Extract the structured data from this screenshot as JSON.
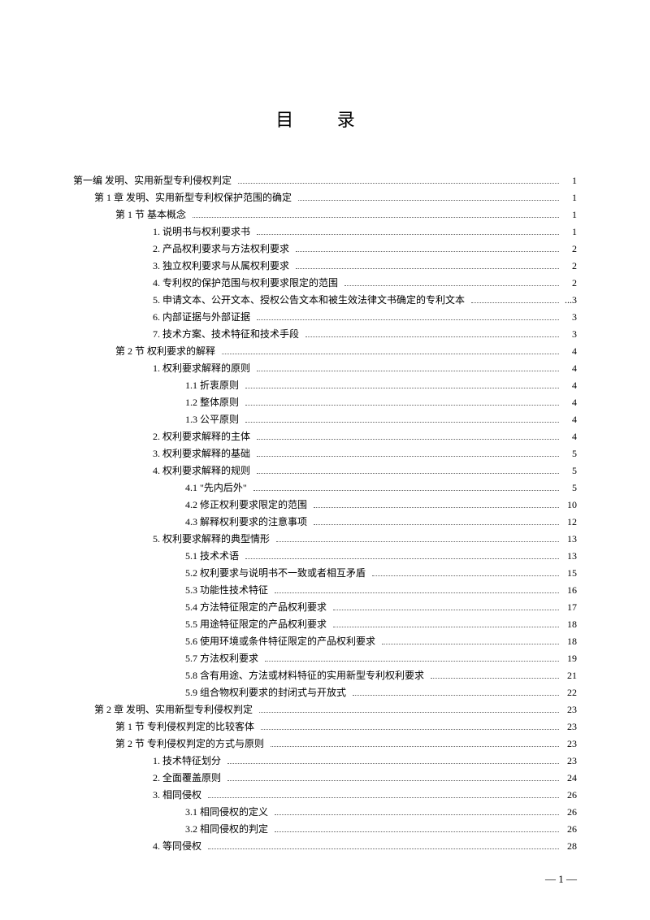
{
  "title": "目 录",
  "footer": "— 1 —",
  "entries": [
    {
      "indent": 0,
      "text": "第一编  发明、实用新型专利侵权判定",
      "page": "1"
    },
    {
      "indent": 1,
      "text": "第 1 章  发明、实用新型专利权保护范围的确定",
      "page": "1"
    },
    {
      "indent": 2,
      "text": "第 1 节  基本概念",
      "page": "1"
    },
    {
      "indent": 3,
      "text": "1. 说明书与权利要求书",
      "page": "1"
    },
    {
      "indent": 3,
      "text": "2. 产品权利要求与方法权利要求",
      "page": "2"
    },
    {
      "indent": 3,
      "text": "3. 独立权利要求与从属权利要求",
      "page": "2"
    },
    {
      "indent": 3,
      "text": "4. 专利权的保护范围与权利要求限定的范围",
      "page": "2"
    },
    {
      "indent": 3,
      "text": "5. 申请文本、公开文本、授权公告文本和被生效法律文书确定的专利文本",
      "page": "...3"
    },
    {
      "indent": 3,
      "text": "6. 内部证据与外部证据",
      "page": "3"
    },
    {
      "indent": 3,
      "text": "7. 技术方案、技术特征和技术手段",
      "page": "3"
    },
    {
      "indent": 2,
      "text": "第 2 节  权利要求的解释",
      "page": "4"
    },
    {
      "indent": 3,
      "text": "1. 权利要求解释的原则",
      "page": "4"
    },
    {
      "indent": 4,
      "text": "1.1 折衷原则",
      "page": "4"
    },
    {
      "indent": 4,
      "text": "1.2 整体原则",
      "page": "4"
    },
    {
      "indent": 4,
      "text": "1.3 公平原则",
      "page": "4"
    },
    {
      "indent": 3,
      "text": "2. 权利要求解释的主体",
      "page": "4"
    },
    {
      "indent": 3,
      "text": "3. 权利要求解释的基础",
      "page": "5"
    },
    {
      "indent": 3,
      "text": "4. 权利要求解释的规则",
      "page": "5"
    },
    {
      "indent": 4,
      "text": "4.1 \"先内后外\"",
      "page": "5"
    },
    {
      "indent": 4,
      "text": "4.2 修正权利要求限定的范围",
      "page": "10"
    },
    {
      "indent": 4,
      "text": "4.3 解释权利要求的注意事项",
      "page": "12"
    },
    {
      "indent": 3,
      "text": "5. 权利要求解释的典型情形",
      "page": "13"
    },
    {
      "indent": 4,
      "text": "5.1 技术术语",
      "page": "13"
    },
    {
      "indent": 4,
      "text": "5.2 权利要求与说明书不一致或者相互矛盾",
      "page": "15"
    },
    {
      "indent": 4,
      "text": "5.3 功能性技术特征",
      "page": "16"
    },
    {
      "indent": 4,
      "text": "5.4 方法特征限定的产品权利要求",
      "page": "17"
    },
    {
      "indent": 4,
      "text": "5.5 用途特征限定的产品权利要求",
      "page": "18"
    },
    {
      "indent": 4,
      "text": "5.6 使用环境或条件特征限定的产品权利要求",
      "page": "18"
    },
    {
      "indent": 4,
      "text": "5.7 方法权利要求",
      "page": "19"
    },
    {
      "indent": 4,
      "text": "5.8 含有用途、方法或材料特征的实用新型专利权利要求",
      "page": "21"
    },
    {
      "indent": 4,
      "text": "5.9 组合物权利要求的封闭式与开放式",
      "page": "22"
    },
    {
      "indent": 1,
      "text": "第 2 章  发明、实用新型专利侵权判定",
      "page": "23"
    },
    {
      "indent": 2,
      "text": "第 1 节  专利侵权判定的比较客体",
      "page": "23"
    },
    {
      "indent": 2,
      "text": "第 2 节  专利侵权判定的方式与原则",
      "page": "23"
    },
    {
      "indent": 3,
      "text": "1. 技术特征划分",
      "page": "23"
    },
    {
      "indent": 3,
      "text": "2. 全面覆盖原则",
      "page": "24"
    },
    {
      "indent": 3,
      "text": "3. 相同侵权",
      "page": "26"
    },
    {
      "indent": 4,
      "text": "3.1 相同侵权的定义",
      "page": "26"
    },
    {
      "indent": 4,
      "text": "3.2 相同侵权的判定",
      "page": "26"
    },
    {
      "indent": 3,
      "text": "4. 等同侵权",
      "page": "28"
    }
  ]
}
